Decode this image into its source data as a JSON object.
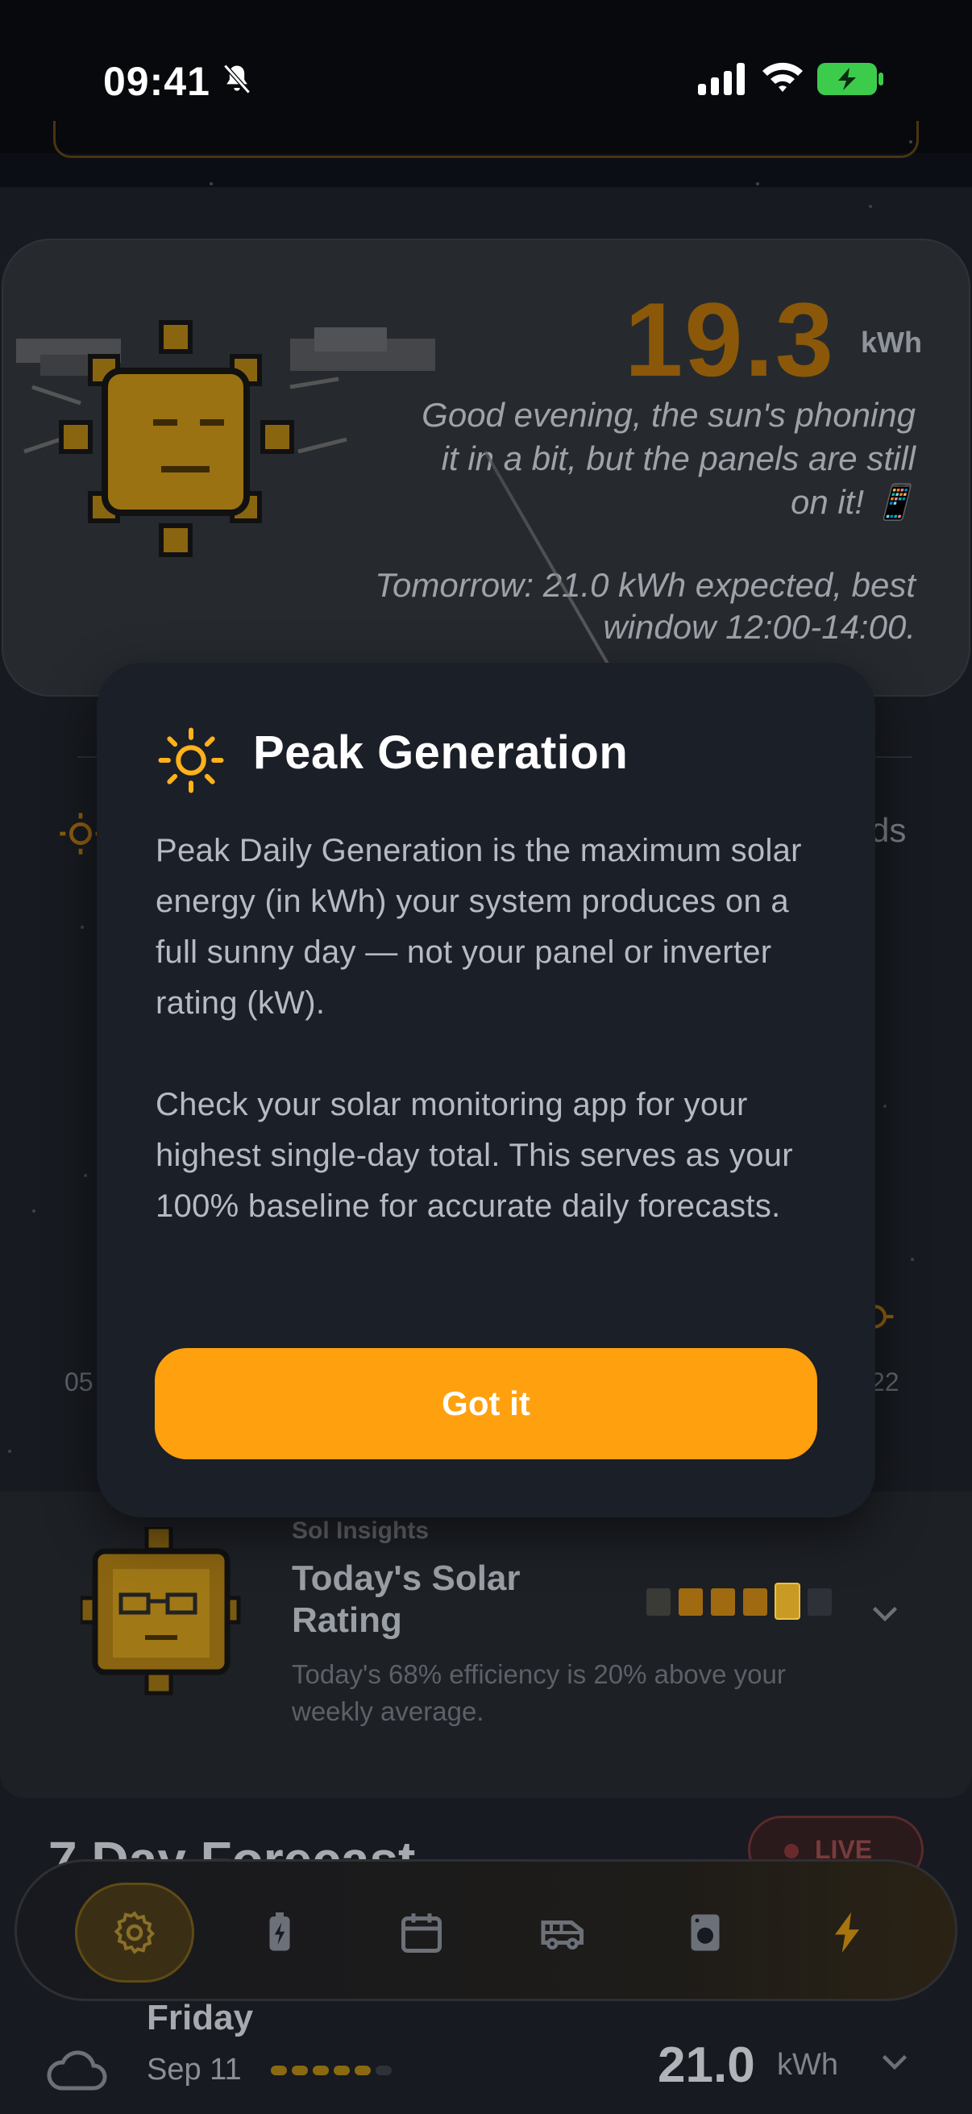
{
  "status_bar": {
    "time": "09:41",
    "icons": [
      "bell-off-icon",
      "cellular-signal-icon",
      "wifi-icon",
      "battery-charging-icon"
    ]
  },
  "hero": {
    "energy_value": "19.3",
    "energy_unit": "kWh",
    "greeting": "Good evening, the sun's phoning it in a bit, but the panels are still on it! 📱",
    "tomorrow": "Tomorrow: 21.0 kWh expected, best window 12:00-14:00."
  },
  "background": {
    "partial_right_text": "ds",
    "axis_left": "05",
    "axis_right": "22"
  },
  "insights": {
    "kicker": "Sol Insights",
    "title": "Today's Solar Rating",
    "description": "Today's 68% efficiency is 20% above your weekly average.",
    "rating_filled": 4,
    "rating_total": 6
  },
  "forecast": {
    "title": "7 Day Forecast",
    "live_label": "LIVE",
    "day": {
      "name": "Friday",
      "date": "Sep 11",
      "value": "21.0",
      "unit": "kWh",
      "icon": "cloud-icon"
    }
  },
  "tabbar": {
    "tabs": [
      "settings-icon",
      "battery-icon",
      "calendar-icon",
      "van-icon",
      "washer-icon",
      "lightning-icon"
    ],
    "active_index": 0
  },
  "modal": {
    "title": "Peak Generation",
    "icon": "sun-icon",
    "paragraph_1": "Peak Daily Generation is the maximum solar energy (in kWh) your system produces on a full sunny day — not your panel or inverter rating (kW).",
    "paragraph_2": "Check your solar monitoring app for your highest single-day total. This serves as your 100% baseline for accurate daily forecasts.",
    "button_label": "Got it"
  },
  "colors": {
    "accent": "#ffa00f",
    "modal_bg": "#1b1f27",
    "page_bg": "#0b0e14"
  }
}
